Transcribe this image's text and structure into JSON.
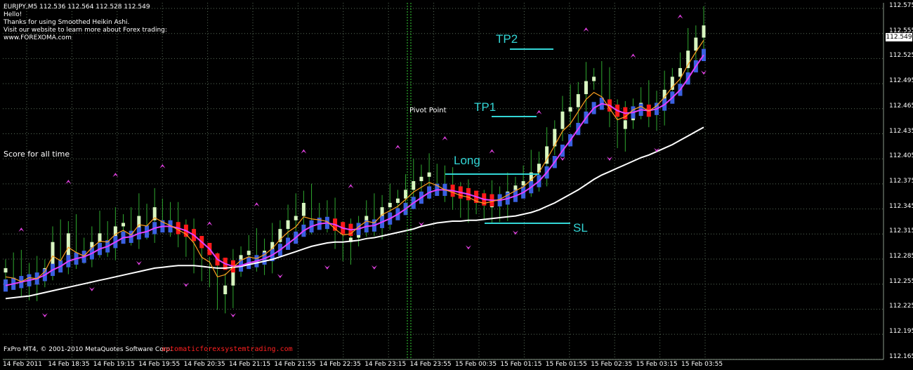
{
  "header": {
    "symbol_line": "EURJPY,M5  112.536 112.564 112.528 112.549",
    "lines": [
      "Hello!",
      "Thanks for using Smoothed Heikin Ashi.",
      "Visit our website to learn more about Forex trading:",
      "www.FOREXOMA.com"
    ]
  },
  "labels": {
    "score": "Score for all time",
    "pivot": "Pivot Point",
    "footer": "FxPro MT4, © 2001-2010 MetaQuotes Software Corp.",
    "watermark": "automaticforexsystemtrading.com"
  },
  "annotations": {
    "tp2": "TP2",
    "tp1": "TP1",
    "long": "Long",
    "sl": "SL"
  },
  "current_price": "112.549",
  "colors": {
    "background": "#000000",
    "grid": "#5a6e5a",
    "bull_candle": "#d8f5c0",
    "wick": "#2fa82f",
    "ha_bull": "#3a60e0",
    "ha_bear": "#ff1a1a",
    "ma_fast": "#ffa020",
    "ma_mid": "#e040ff",
    "ma_slow": "#ffffff",
    "arrow": "#e040e0",
    "annotation": "#33d6d6",
    "watermark": "#ff2020"
  },
  "chart_data": {
    "type": "line",
    "title": "EURJPY,M5",
    "x_ticks": [
      "14 Feb 2011",
      "14 Feb 18:35",
      "14 Feb 19:15",
      "14 Feb 19:55",
      "14 Feb 20:35",
      "14 Feb 21:15",
      "14 Feb 21:55",
      "14 Feb 22:35",
      "14 Feb 23:15",
      "14 Feb 23:55",
      "15 Feb 00:35",
      "15 Feb 01:15",
      "15 Feb 01:55",
      "15 Feb 02:35",
      "15 Feb 03:15",
      "15 Feb 03:55"
    ],
    "y_ticks": [
      "112.575",
      "112.555",
      "112.525",
      "112.495",
      "112.465",
      "112.435",
      "112.405",
      "112.375",
      "112.345",
      "112.315",
      "112.285",
      "112.255",
      "112.225",
      "112.195",
      "112.165"
    ],
    "ylim": [
      112.165,
      112.575
    ],
    "grid": true,
    "series": [
      {
        "name": "close",
        "values": [
          112.27,
          112.265,
          112.255,
          112.262,
          112.258,
          112.27,
          112.3,
          112.285,
          112.31,
          112.295,
          112.285,
          112.3,
          112.31,
          112.305,
          112.318,
          112.322,
          112.31,
          112.33,
          112.325,
          112.34,
          112.328,
          112.32,
          112.312,
          112.305,
          112.29,
          112.265,
          112.262,
          112.24,
          112.25,
          112.27,
          112.285,
          112.29,
          112.284,
          112.29,
          112.3,
          112.315,
          112.325,
          112.33,
          112.345,
          112.335,
          112.33,
          112.325,
          112.31,
          112.3,
          112.305,
          112.32,
          112.33,
          112.325,
          112.34,
          112.345,
          112.35,
          112.36,
          112.37,
          112.375,
          112.38,
          112.37,
          112.36,
          112.355,
          112.35,
          112.348,
          112.342,
          112.34,
          112.345,
          112.35,
          112.358,
          112.365,
          112.37,
          112.38,
          112.39,
          112.41,
          112.43,
          112.45,
          112.455,
          112.47,
          112.485,
          112.49,
          112.475,
          112.45,
          112.43,
          112.44,
          112.455,
          112.46,
          112.45,
          112.46,
          112.475,
          112.49,
          112.5,
          112.52,
          112.535,
          112.549
        ]
      },
      {
        "name": "ma_fast",
        "values": [
          112.25,
          112.252,
          112.254,
          112.256,
          112.258,
          112.262,
          112.268,
          112.272,
          112.278,
          112.281,
          112.283,
          112.287,
          112.292,
          112.295,
          112.3,
          112.305,
          112.306,
          112.31,
          112.312,
          112.316,
          112.318,
          112.318,
          112.316,
          112.313,
          112.308,
          112.3,
          112.292,
          112.28,
          112.275,
          112.272,
          112.273,
          112.276,
          112.278,
          112.281,
          112.285,
          112.291,
          112.298,
          112.305,
          112.313,
          112.318,
          112.321,
          112.322,
          112.32,
          112.316,
          112.314,
          112.315,
          112.318,
          112.319,
          112.323,
          112.327,
          112.332,
          112.338,
          112.345,
          112.351,
          112.357,
          112.36,
          112.36,
          112.359,
          112.357,
          112.355,
          112.352,
          112.349,
          112.348,
          112.348,
          112.35,
          112.353,
          112.357,
          112.363,
          112.37,
          112.38,
          112.392,
          112.405,
          112.417,
          112.43,
          112.443,
          112.454,
          112.459,
          112.457,
          112.451,
          112.448,
          112.449,
          112.452,
          112.451,
          112.453,
          112.458,
          112.466,
          112.475,
          112.488,
          112.502,
          112.515
        ]
      },
      {
        "name": "ma_slow",
        "values": [
          112.235,
          112.236,
          112.237,
          112.238,
          112.24,
          112.242,
          112.244,
          112.246,
          112.248,
          112.25,
          112.252,
          112.254,
          112.256,
          112.258,
          112.26,
          112.262,
          112.264,
          112.266,
          112.268,
          112.27,
          112.271,
          112.272,
          112.273,
          112.273,
          112.273,
          112.272,
          112.271,
          112.27,
          112.27,
          112.271,
          112.272,
          112.274,
          112.276,
          112.278,
          112.28,
          112.283,
          112.286,
          112.289,
          112.292,
          112.295,
          112.297,
          112.299,
          112.3,
          112.3,
          112.301,
          112.302,
          112.304,
          112.305,
          112.307,
          112.309,
          112.311,
          112.313,
          112.315,
          112.318,
          112.32,
          112.322,
          112.323,
          112.324,
          112.324,
          112.325,
          112.325,
          112.326,
          112.327,
          112.328,
          112.329,
          112.33,
          112.332,
          112.334,
          112.337,
          112.341,
          112.345,
          112.35,
          112.355,
          112.36,
          112.366,
          112.372,
          112.377,
          112.381,
          112.385,
          112.389,
          112.393,
          112.397,
          112.4,
          112.404,
          112.408,
          112.412,
          112.417,
          112.422,
          112.427,
          112.432
        ]
      }
    ]
  }
}
